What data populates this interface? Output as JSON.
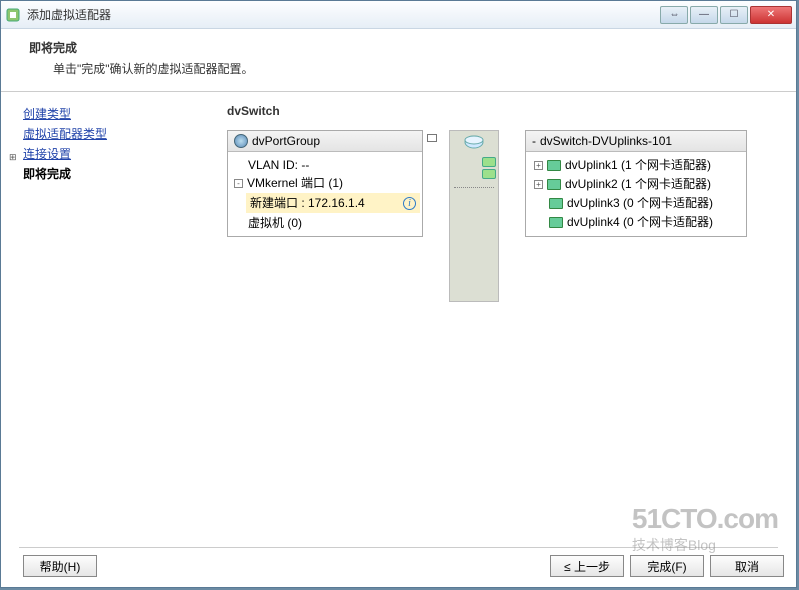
{
  "window": {
    "title": "添加虚拟适配器"
  },
  "header": {
    "title": "即将完成",
    "description": "单击\"完成\"确认新的虚拟适配器配置。"
  },
  "sidebar": {
    "items": [
      {
        "label": "创建类型",
        "link": true
      },
      {
        "label": "虚拟适配器类型",
        "link": true
      },
      {
        "label": "连接设置",
        "link": true,
        "expandable": true
      },
      {
        "label": "即将完成",
        "bold": true
      }
    ]
  },
  "main": {
    "title": "dvSwitch",
    "portgroup": {
      "name": "dvPortGroup",
      "vlan_label": "VLAN ID: --",
      "vmkernel_label": "VMkernel 端口 (1)",
      "new_port_label": "新建端口 : 172.16.1.4",
      "vm_label": "虚拟机 (0)"
    },
    "uplinks": {
      "name": "dvSwitch-DVUplinks-101",
      "items": [
        {
          "label": "dvUplink1 (1 个网卡适配器)",
          "exp": true
        },
        {
          "label": "dvUplink2 (1 个网卡适配器)",
          "exp": true
        },
        {
          "label": "dvUplink3 (0 个网卡适配器)",
          "exp": false
        },
        {
          "label": "dvUplink4 (0 个网卡适配器)",
          "exp": false
        }
      ]
    }
  },
  "footer": {
    "help": "帮助(H)",
    "back": "≤ 上一步",
    "finish": "完成(F)",
    "cancel": "取消"
  },
  "watermark": {
    "line1": "51CTO.com",
    "line2": "技术博客Blog"
  }
}
